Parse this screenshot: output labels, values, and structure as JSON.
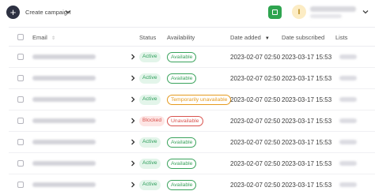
{
  "topbar": {
    "add_icon": "plus-icon",
    "add_symbol": "+",
    "create_label": "Create campaign",
    "avatar_initial": "I"
  },
  "table": {
    "columns": {
      "email": "Email",
      "status": "Status",
      "availability": "Availability",
      "date_added": "Date added",
      "date_subscribed": "Date subscribed",
      "lists": "Lists"
    },
    "rows": [
      {
        "status": "Active",
        "availability": "Available",
        "date_added": "2023-02-07 02:50",
        "date_subscribed": "2023-03-17 15:53"
      },
      {
        "status": "Active",
        "availability": "Available",
        "date_added": "2023-02-07 02:50",
        "date_subscribed": "2023-03-17 15:53"
      },
      {
        "status": "Active",
        "availability": "Temporarily unavailable",
        "date_added": "2023-02-07 02:50",
        "date_subscribed": "2023-03-17 15:53"
      },
      {
        "status": "Blocked",
        "availability": "Unavailable",
        "date_added": "2023-02-07 02:50",
        "date_subscribed": "2023-03-17 15:53"
      },
      {
        "status": "Active",
        "availability": "Available",
        "date_added": "2023-02-07 02:50",
        "date_subscribed": "2023-03-17 15:53"
      },
      {
        "status": "Active",
        "availability": "Available",
        "date_added": "2023-02-07 02:50",
        "date_subscribed": "2023-03-17 15:53"
      },
      {
        "status": "Active",
        "availability": "Available",
        "date_added": "2023-02-07 02:50",
        "date_subscribed": "2023-03-17 15:53"
      }
    ]
  },
  "colors": {
    "active": "#2e9e5b",
    "active_bg": "#e3f5ea",
    "blocked": "#d9534f",
    "blocked_bg": "#fde5e4",
    "available": "#3aa35c",
    "temporarily_unavailable": "#e59a1f",
    "unavailable": "#d9534f"
  }
}
